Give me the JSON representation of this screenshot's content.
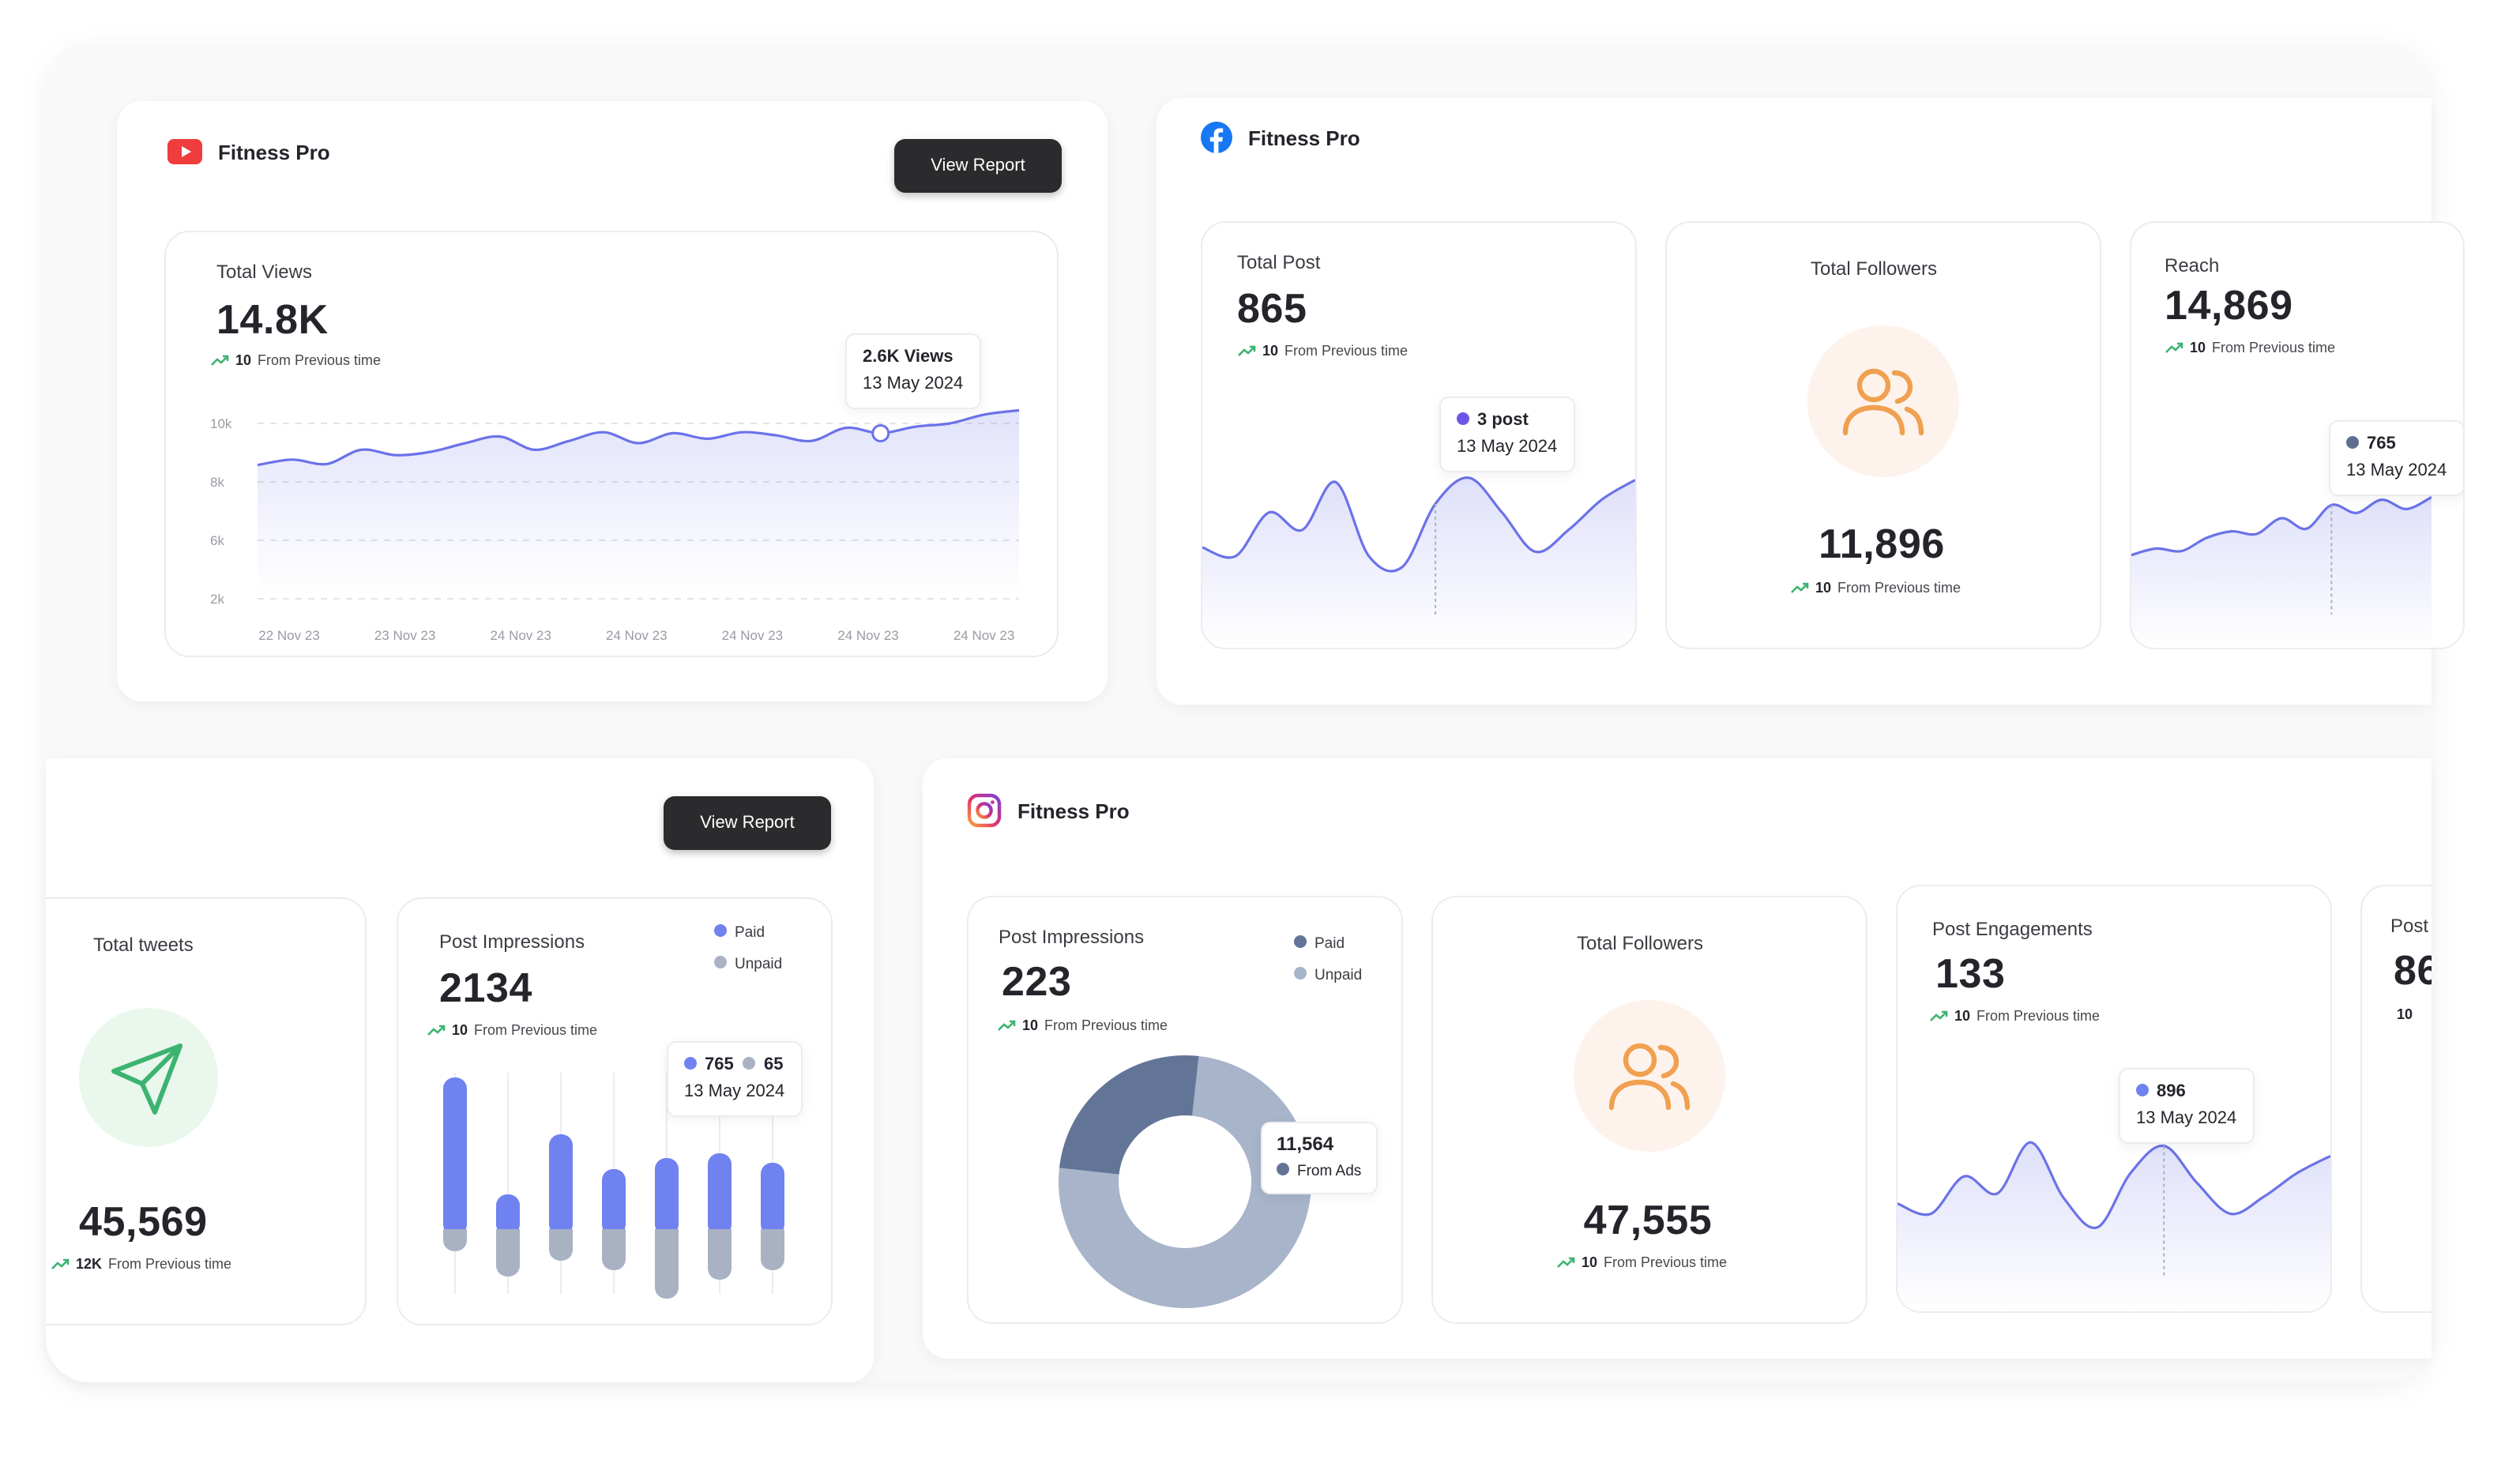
{
  "youtube": {
    "brand": "Fitness Pro",
    "button": "View Report",
    "label": "Total Views",
    "value": "14.8K",
    "delta": {
      "num": "10",
      "text": "From Previous time"
    },
    "tooltip": {
      "value": "2.6K Views",
      "date": "13 May 2024"
    },
    "chart_data": {
      "type": "area",
      "title": "",
      "y_ticks": [
        "10k",
        "8k",
        "6k",
        "2k"
      ],
      "x_ticks": [
        "22 Nov 23",
        "23 Nov 23",
        "24 Nov 23",
        "24 Nov 23",
        "24 Nov 23",
        "24 Nov 23",
        "24 Nov 23"
      ],
      "values": [
        8100,
        8350,
        8150,
        8800,
        8550,
        8700,
        9100,
        9400,
        8800,
        9200,
        9600,
        9100,
        9550,
        9300,
        9600,
        9450,
        9200,
        9800,
        9550,
        9850,
        10000,
        10400,
        10600
      ],
      "highlight_index": 18,
      "ylim": [
        2000,
        11000
      ],
      "accent": "#6b72e8"
    }
  },
  "facebook": {
    "brand": "Fitness Pro",
    "total_post": {
      "label": "Total Post",
      "value": "865",
      "delta": {
        "num": "10",
        "text": "From Previous time"
      },
      "tooltip": {
        "value": "3 post",
        "date": "13 May 2024"
      },
      "chart_data": {
        "type": "area",
        "values": [
          42,
          38,
          58,
          50,
          72,
          38,
          33,
          62,
          74,
          58,
          40,
          50,
          64,
          73
        ],
        "highlight_index": 7,
        "accent": "#6b72e8"
      }
    },
    "total_followers": {
      "label": "Total Followers",
      "value": "11,896",
      "delta": {
        "num": "10",
        "text": "From Previous time"
      }
    },
    "reach": {
      "label": "Reach",
      "value": "14,869",
      "delta": {
        "num": "10",
        "text": "From Previous time"
      },
      "tooltip": {
        "value": "765",
        "date": "13 May 2024"
      },
      "chart_data": {
        "type": "area",
        "values": [
          20,
          25,
          23,
          33,
          38,
          36,
          48,
          40,
          58,
          52,
          62,
          55,
          64
        ],
        "highlight_index": 8,
        "accent": "#6b72e8"
      }
    }
  },
  "twitter": {
    "button": "View Report",
    "total_tweets": {
      "label": "Total tweets",
      "value": "45,569",
      "delta": {
        "num": "12K",
        "text": "From Previous time"
      }
    },
    "post_impressions": {
      "label": "Post Impressions",
      "value": "2134",
      "delta": {
        "num": "10",
        "text": "From Previous time"
      },
      "legend": [
        "Paid",
        "Unpaid"
      ],
      "tooltip": {
        "paid": "765",
        "unpaid": "65",
        "date": "13 May 2024"
      },
      "chart_data": {
        "type": "bar",
        "series": [
          {
            "name": "Paid",
            "values": [
              96,
              22,
              60,
              38,
              45,
              48,
              42
            ]
          },
          {
            "name": "Unpaid",
            "values": [
              14,
              30,
              20,
              26,
              44,
              32,
              26
            ]
          }
        ],
        "colors": [
          "#6f82f0",
          "#a9b2c3"
        ]
      }
    }
  },
  "instagram": {
    "brand": "Fitness Pro",
    "post_impressions": {
      "label": "Post Impressions",
      "value": "223",
      "delta": {
        "num": "10",
        "text": "From Previous time"
      },
      "legend": [
        "Paid",
        "Unpaid"
      ],
      "tooltip": {
        "value": "11,564",
        "text": "From Ads"
      },
      "chart_data": {
        "type": "pie",
        "series": [
          {
            "name": "Paid",
            "value": 25
          },
          {
            "name": "Unpaid",
            "value": 75
          }
        ],
        "colors": [
          "#627597",
          "#a7b4c9"
        ]
      }
    },
    "total_followers": {
      "label": "Total Followers",
      "value": "47,555",
      "delta": {
        "num": "10",
        "text": "From Previous time"
      }
    },
    "post_engagements": {
      "label": "Post Engagements",
      "value": "133",
      "delta": {
        "num": "10",
        "text": "From Previous time"
      },
      "tooltip": {
        "value": "896",
        "date": "13 May 2024"
      },
      "chart_data": {
        "type": "area",
        "values": [
          52,
          46,
          68,
          58,
          88,
          55,
          38,
          70,
          86,
          64,
          46,
          56,
          70,
          80
        ],
        "highlight_index": 8,
        "accent": "#6b72e8"
      }
    },
    "partial_card": {
      "label": "Post",
      "value": "86",
      "delta_num": "10"
    }
  }
}
